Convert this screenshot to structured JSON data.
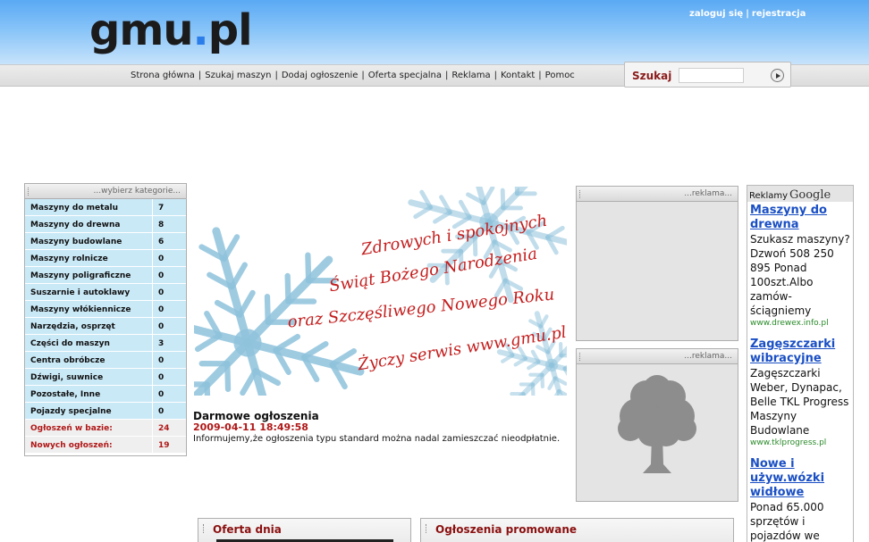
{
  "header": {
    "logo_main": "gmu",
    "logo_dot": ".",
    "logo_tld": "pl",
    "login_label": "zaloguj się",
    "separator": "|",
    "register_label": "rejestracja"
  },
  "nav": {
    "items": [
      "Strona główna",
      "Szukaj maszyn",
      "Dodaj ogłoszenie",
      "Oferta specjalna",
      "Reklama",
      "Kontakt",
      "Pomoc"
    ],
    "separator": "|"
  },
  "search": {
    "label": "Szukaj",
    "value": "",
    "button_icon": "play-arrow-icon"
  },
  "categories": {
    "title": "...wybierz kategorie...",
    "items": [
      {
        "name": "Maszyny do metalu",
        "count": "7"
      },
      {
        "name": "Maszyny do drewna",
        "count": "8"
      },
      {
        "name": "Maszyny budowlane",
        "count": "6"
      },
      {
        "name": "Maszyny rolnicze",
        "count": "0"
      },
      {
        "name": "Maszyny poligraficzne",
        "count": "0"
      },
      {
        "name": "Suszarnie i autoklawy",
        "count": "0"
      },
      {
        "name": "Maszyny włókiennicze",
        "count": "0"
      },
      {
        "name": "Narzędzia, osprzęt",
        "count": "0"
      },
      {
        "name": "Części do maszyn",
        "count": "3"
      },
      {
        "name": "Centra obróbcze",
        "count": "0"
      },
      {
        "name": "Dźwigi, suwnice",
        "count": "0"
      },
      {
        "name": "Pozostałe, Inne",
        "count": "0"
      },
      {
        "name": "Pojazdy specjalne",
        "count": "0"
      }
    ],
    "stats": [
      {
        "name": "Ogłoszeń w bazie:",
        "count": "24"
      },
      {
        "name": "Nowych ogłoszeń:",
        "count": "19"
      }
    ]
  },
  "banner": {
    "lines": [
      "Zdrowych i spokojnych",
      "Świąt Bożego Narodzenia",
      "oraz Szczęśliwego Nowego Roku",
      "Życzy serwis www.gmu.pl"
    ],
    "colors": {
      "text": "#c41e1e",
      "snowflake": "#8fc3dc"
    }
  },
  "news": {
    "title": "Darmowe ogłoszenia",
    "date": "2009-04-11 18:49:58",
    "body": "Informujemy,że ogłoszenia typu standard można nadal zamieszczać nieodpłatnie."
  },
  "ad_panels": [
    {
      "title": "...reklama..."
    },
    {
      "title": "...reklama..."
    }
  ],
  "google_ads": {
    "header_label": "Reklamy",
    "header_brand": "Google",
    "ads": [
      {
        "title": "Maszyny do drewna",
        "text": "Szukasz maszyny?Dzwoń 508 250 895 Ponad 100szt.Albo zamów-ściągniemy",
        "url": "www.drewex.info.pl"
      },
      {
        "title": "Zagęszczarki wibracyjne",
        "text": "Zagęszczarki Weber, Dynapac, Belle TKL Progress Maszyny Budowlane",
        "url": "www.tklprogress.pl"
      },
      {
        "title": "Nowe i używ.wózki widłowe",
        "text": "Ponad 65.000 sprzętów i pojazdów we",
        "url": ""
      }
    ]
  },
  "bottom": {
    "offer_title": "Oferta dnia",
    "promoted_title": "Ogłoszenia promowane"
  },
  "colors": {
    "header_blue": "#5aa9f4",
    "accent_red": "#b01818",
    "category_bg": "#c9e9f7",
    "link_blue": "#1a4fc4",
    "url_green": "#2a8a2a"
  }
}
